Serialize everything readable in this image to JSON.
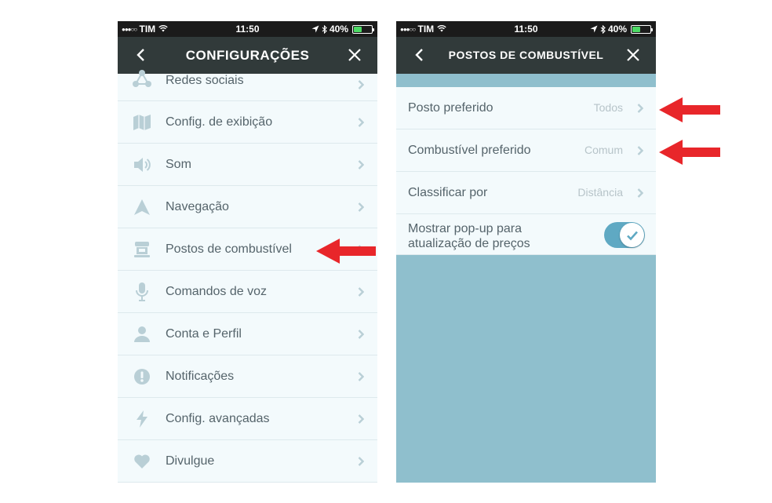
{
  "left_screen": {
    "status": {
      "carrier": "TIM",
      "signal_dots": "●●●○○",
      "time": "11:50",
      "battery": "40%"
    },
    "nav": {
      "title": "CONFIGURAÇÕES"
    },
    "items": [
      {
        "label": "Redes sociais",
        "icon": "share-icon"
      },
      {
        "label": "Config. de exibição",
        "icon": "map-icon"
      },
      {
        "label": "Som",
        "icon": "speaker-icon"
      },
      {
        "label": "Navegação",
        "icon": "navigation-arrow-icon"
      },
      {
        "label": "Postos de combustível",
        "icon": "gas-station-icon"
      },
      {
        "label": "Comandos de voz",
        "icon": "microphone-icon"
      },
      {
        "label": "Conta e Perfil",
        "icon": "user-icon"
      },
      {
        "label": "Notificações",
        "icon": "exclamation-icon"
      },
      {
        "label": "Config. avançadas",
        "icon": "lightning-icon"
      },
      {
        "label": "Divulgue",
        "icon": "heart-icon"
      }
    ]
  },
  "right_screen": {
    "status": {
      "carrier": "TIM",
      "signal_dots": "●●●○○",
      "time": "11:50",
      "battery": "40%"
    },
    "nav": {
      "title": "POSTOS DE COMBUSTÍVEL"
    },
    "settings": [
      {
        "label": "Posto preferido",
        "value": "Todos"
      },
      {
        "label": "Combustível preferido",
        "value": "Comum"
      },
      {
        "label": "Classificar por",
        "value": "Distância"
      }
    ],
    "toggle": {
      "label_line1": "Mostrar pop-up para",
      "label_line2": "atualização de preços",
      "state": "on"
    }
  },
  "colors": {
    "nav_bar": "#313a3a",
    "status_bar": "#1b1b1b",
    "list_background": "#f3fafc",
    "teal_background": "#8fbfcd",
    "label_text": "#55646b",
    "icon": "#b9cfd6",
    "toggle_on": "#5fa9c3",
    "annotation_arrow": "#e8262a"
  }
}
